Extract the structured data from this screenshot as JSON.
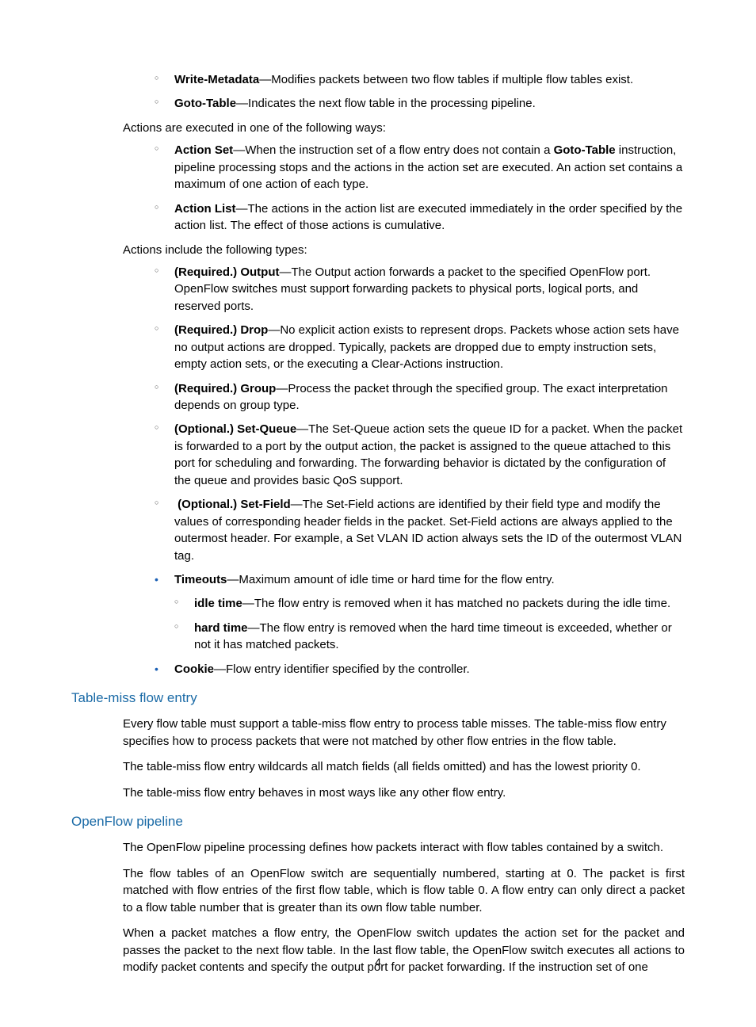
{
  "items": {
    "writeMetadata": {
      "term": "Write-Metadata",
      "desc": "—Modifies packets between two flow tables if multiple flow tables exist."
    },
    "gotoTable": {
      "term": "Goto-Table",
      "desc": "—Indicates the next flow table in the processing pipeline."
    }
  },
  "intro1": "Actions are executed in one of the following ways:",
  "actionSet": {
    "term": "Action Set",
    "d1": "—When the instruction set of a flow entry does not contain a ",
    "term2": "Goto-Table",
    "d2": " instruction, pipeline processing stops and the actions in the action set are executed. An action set contains a maximum of one action of each type."
  },
  "actionList": {
    "term": "Action List",
    "desc": "—The actions in the action list are executed immediately in the order specified by the action list. The effect of those actions is cumulative."
  },
  "intro2": "Actions include the following types:",
  "output": {
    "term": "(Required.) Output",
    "desc": "—The Output action forwards a packet to the specified OpenFlow port. OpenFlow switches must support forwarding packets to physical ports, logical ports, and reserved ports."
  },
  "drop": {
    "term": "(Required.) Drop",
    "desc": "—No explicit action exists to represent drops. Packets whose action sets have no output actions are dropped. Typically, packets are dropped due to empty instruction sets, empty action sets, or the executing a Clear-Actions instruction."
  },
  "group": {
    "term": "(Required.) Group",
    "desc": "—Process the packet through the specified group. The exact interpretation depends on group type."
  },
  "setQueue": {
    "term": "(Optional.) Set-Queue",
    "desc": "—The Set-Queue action sets the queue ID for a packet. When the packet is forwarded to a port by the output action, the packet is assigned to the queue attached to this port for scheduling and forwarding. The forwarding behavior is dictated by the configuration of the queue and provides basic QoS support."
  },
  "setField": {
    "term": "(Optional.) Set-Field",
    "desc": "—The Set-Field actions are identified by their field type and modify the values of corresponding header fields in the packet. Set-Field actions are always applied to the outermost header. For example, a Set VLAN ID action always sets the ID of the outermost VLAN tag."
  },
  "timeouts": {
    "term": "Timeouts",
    "desc": "—Maximum amount of idle time or hard time for the flow entry."
  },
  "idle": {
    "term": "idle time",
    "desc": "—The flow entry is removed when it has matched no packets during the idle time."
  },
  "hard": {
    "term": "hard time",
    "desc": "—The flow entry is removed when the hard time timeout is exceeded, whether or not it has matched packets."
  },
  "cookie": {
    "term": "Cookie",
    "desc": "—Flow entry identifier specified by the controller."
  },
  "h_tablemiss": "Table-miss flow entry",
  "tm1": "Every flow table must support a table-miss flow entry to process table misses. The table-miss flow entry specifies how to process packets that were not matched by other flow entries in the flow table.",
  "tm2": "The table-miss flow entry wildcards all match fields (all fields omitted) and has the lowest priority 0.",
  "tm3": "The table-miss flow entry behaves in most ways like any other flow entry.",
  "h_pipeline": "OpenFlow pipeline",
  "p1": "The OpenFlow pipeline processing defines how packets interact with flow tables contained by a switch.",
  "p2": "The flow tables of an OpenFlow switch are sequentially numbered, starting at 0. The packet is first matched with flow entries of the first flow table, which is flow table 0. A flow entry can only direct a packet to a flow table number that is greater than its own flow table number.",
  "p3": "When a packet matches a flow entry, the OpenFlow switch updates the action set for the packet and passes the packet to the next flow table. In the last flow table, the OpenFlow switch executes all actions to modify packet contents and specify the output port for packet forwarding. If the instruction set of one",
  "pagenum": "4"
}
